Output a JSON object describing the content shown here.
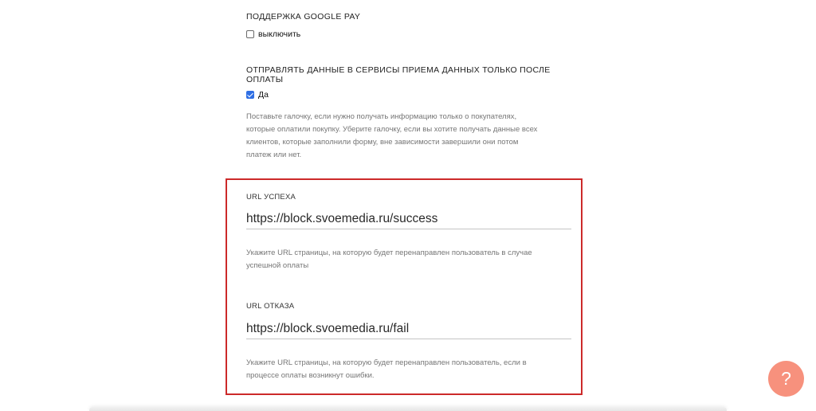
{
  "google_pay": {
    "title": "ПОДДЕРЖКА GOOGLE PAY",
    "checkbox_label": "выключить",
    "checked": false
  },
  "paid_only": {
    "title_line1": "ОТПРАВЛЯТЬ ДАННЫЕ В СЕРВИСЫ ПРИЕМА ДАННЫХ ТОЛЬКО ПОСЛЕ",
    "title_line2": "ОПЛАТЫ",
    "checkbox_label": "Да",
    "checked": true,
    "hint_lines": [
      "Поставьте галочку, если нужно получать информацию только о покупателях,",
      "которые оплатили покупку. Уберите галочку, если вы хотите получать данные всех",
      "клиентов, которые заполнили форму, вне зависимости завершили они потом",
      "платеж или нет."
    ]
  },
  "success_url": {
    "label": "URL УСПЕХА",
    "value": "https://block.svoemedia.ru/success",
    "hint_lines": [
      "Укажите URL страницы, на которую будет перенаправлен пользователь в случае",
      "успешной оплаты"
    ]
  },
  "fail_url": {
    "label": "URL ОТКАЗА",
    "value": "https://block.svoemedia.ru/fail",
    "hint_lines": [
      "Укажите URL страницы, на которую будет перенаправлен пользователь, если в",
      "процессе оплаты возникнут ошибки."
    ]
  },
  "help": {
    "glyph": "?",
    "icon": "question-mark-icon",
    "color": "#f7917d"
  },
  "colors": {
    "highlight_border": "#cc2a2a",
    "checkbox_checked": "#2f6fe4",
    "hint_text": "#767676"
  }
}
